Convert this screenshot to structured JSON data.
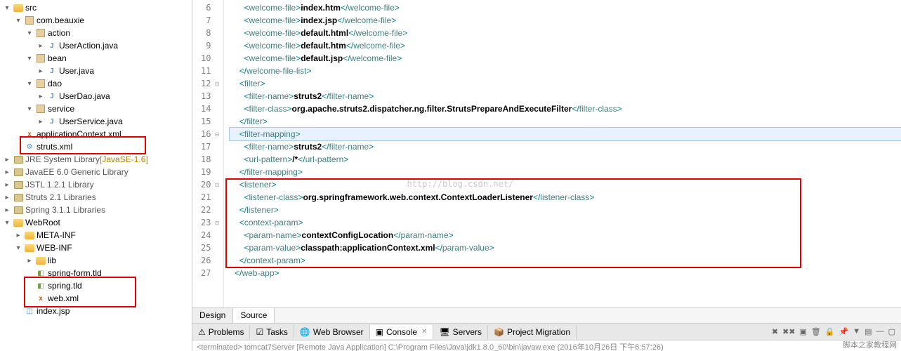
{
  "tree": {
    "items": [
      {
        "ind": 1,
        "tw": "▾",
        "icon": "folder",
        "label": "src"
      },
      {
        "ind": 2,
        "tw": "▾",
        "icon": "package",
        "label": "com.beauxie"
      },
      {
        "ind": 3,
        "tw": "▾",
        "icon": "package",
        "label": "action"
      },
      {
        "ind": 4,
        "tw": "▸",
        "icon": "java",
        "label": "UserAction.java"
      },
      {
        "ind": 3,
        "tw": "▾",
        "icon": "package",
        "label": "bean"
      },
      {
        "ind": 4,
        "tw": "▸",
        "icon": "java",
        "label": "User.java"
      },
      {
        "ind": 3,
        "tw": "▾",
        "icon": "package",
        "label": "dao"
      },
      {
        "ind": 4,
        "tw": "▸",
        "icon": "java",
        "label": "UserDao.java"
      },
      {
        "ind": 3,
        "tw": "▾",
        "icon": "package",
        "label": "service"
      },
      {
        "ind": 4,
        "tw": "▸",
        "icon": "java",
        "label": "UserService.java"
      },
      {
        "ind": 2,
        "tw": "",
        "icon": "xml",
        "label": "applicationContext.xml"
      },
      {
        "ind": 2,
        "tw": "",
        "icon": "gear",
        "label": "struts.xml"
      },
      {
        "ind": 1,
        "tw": "▸",
        "icon": "lib",
        "label": "JRE System Library",
        "ver": "[JavaSE-1.6]",
        "lib": true
      },
      {
        "ind": 1,
        "tw": "▸",
        "icon": "lib",
        "label": "JavaEE 6.0 Generic Library",
        "lib": true
      },
      {
        "ind": 1,
        "tw": "▸",
        "icon": "lib",
        "label": "JSTL 1.2.1 Library",
        "lib": true
      },
      {
        "ind": 1,
        "tw": "▸",
        "icon": "lib",
        "label": "Struts 2.1 Libraries",
        "lib": true
      },
      {
        "ind": 1,
        "tw": "▸",
        "icon": "lib",
        "label": "Spring 3.1.1 Libraries",
        "lib": true
      },
      {
        "ind": 1,
        "tw": "▾",
        "icon": "folder",
        "label": "WebRoot"
      },
      {
        "ind": 2,
        "tw": "▸",
        "icon": "folder",
        "label": "META-INF"
      },
      {
        "ind": 2,
        "tw": "▾",
        "icon": "folder",
        "label": "WEB-INF"
      },
      {
        "ind": 3,
        "tw": "▸",
        "icon": "folder",
        "label": "lib"
      },
      {
        "ind": 3,
        "tw": "",
        "icon": "tld",
        "label": "spring-form.tld"
      },
      {
        "ind": 3,
        "tw": "",
        "icon": "tld",
        "label": "spring.tld"
      },
      {
        "ind": 3,
        "tw": "",
        "icon": "xml",
        "label": "web.xml"
      },
      {
        "ind": 2,
        "tw": "",
        "icon": "jsp",
        "label": "index.jsp"
      }
    ]
  },
  "code": {
    "lines": [
      {
        "n": 6,
        "indent": 3,
        "parts": [
          [
            "tag",
            "<welcome-file>"
          ],
          [
            "txtb",
            "index.htm"
          ],
          [
            "tag",
            "</welcome-file>"
          ]
        ]
      },
      {
        "n": 7,
        "indent": 3,
        "parts": [
          [
            "tag",
            "<welcome-file>"
          ],
          [
            "txtb",
            "index.jsp"
          ],
          [
            "tag",
            "</welcome-file>"
          ]
        ]
      },
      {
        "n": 8,
        "indent": 3,
        "parts": [
          [
            "tag",
            "<welcome-file>"
          ],
          [
            "txtb",
            "default.html"
          ],
          [
            "tag",
            "</welcome-file>"
          ]
        ]
      },
      {
        "n": 9,
        "indent": 3,
        "parts": [
          [
            "tag",
            "<welcome-file>"
          ],
          [
            "txtb",
            "default.htm"
          ],
          [
            "tag",
            "</welcome-file>"
          ]
        ]
      },
      {
        "n": 10,
        "indent": 3,
        "parts": [
          [
            "tag",
            "<welcome-file>"
          ],
          [
            "txtb",
            "default.jsp"
          ],
          [
            "tag",
            "</welcome-file>"
          ]
        ]
      },
      {
        "n": 11,
        "indent": 2,
        "parts": [
          [
            "tag",
            "</welcome-file-list>"
          ]
        ]
      },
      {
        "n": 12,
        "fold": true,
        "indent": 2,
        "parts": [
          [
            "tag",
            "<filter>"
          ]
        ]
      },
      {
        "n": 13,
        "indent": 3,
        "parts": [
          [
            "tag",
            "<filter-name>"
          ],
          [
            "txtb",
            "struts2"
          ],
          [
            "tag",
            "</filter-name>"
          ]
        ]
      },
      {
        "n": 14,
        "indent": 3,
        "parts": [
          [
            "tag",
            "<filter-class>"
          ],
          [
            "txtb",
            "org.apache.struts2.dispatcher.ng.filter.StrutsPrepareAndExecuteFilter"
          ],
          [
            "tag",
            "</filter-class>"
          ]
        ]
      },
      {
        "n": 15,
        "indent": 2,
        "parts": [
          [
            "tag",
            "</filter>"
          ]
        ]
      },
      {
        "n": 16,
        "fold": true,
        "cursor": true,
        "indent": 2,
        "parts": [
          [
            "tag",
            "<filter-mapping>"
          ]
        ]
      },
      {
        "n": 17,
        "indent": 3,
        "parts": [
          [
            "tag",
            "<filter-name>"
          ],
          [
            "txtb",
            "struts2"
          ],
          [
            "tag",
            "</filter-name>"
          ]
        ]
      },
      {
        "n": 18,
        "indent": 3,
        "parts": [
          [
            "tag",
            "<url-pattern>"
          ],
          [
            "txtb",
            "/*"
          ],
          [
            "tag",
            "</url-pattern>"
          ]
        ]
      },
      {
        "n": 19,
        "indent": 2,
        "parts": [
          [
            "tag",
            "</filter-mapping>"
          ]
        ]
      },
      {
        "n": 20,
        "fold": true,
        "indent": 2,
        "parts": [
          [
            "tag",
            "<listener>"
          ]
        ]
      },
      {
        "n": 21,
        "indent": 3,
        "parts": [
          [
            "tag",
            "<listener-class>"
          ],
          [
            "txtb",
            "org.springframework.web.context.ContextLoaderListener"
          ],
          [
            "tag",
            "</listener-class>"
          ]
        ]
      },
      {
        "n": 22,
        "indent": 2,
        "parts": [
          [
            "tag",
            "</listener>"
          ]
        ]
      },
      {
        "n": 23,
        "fold": true,
        "indent": 2,
        "parts": [
          [
            "tag",
            "<context-param>"
          ]
        ]
      },
      {
        "n": 24,
        "indent": 3,
        "parts": [
          [
            "tag",
            "<param-name>"
          ],
          [
            "txtb",
            "contextConfigLocation"
          ],
          [
            "tag",
            "</param-name>"
          ]
        ]
      },
      {
        "n": 25,
        "indent": 3,
        "parts": [
          [
            "tag",
            "<param-value>"
          ],
          [
            "txtb",
            "classpath:applicationContext.xml"
          ],
          [
            "tag",
            "</param-value>"
          ]
        ]
      },
      {
        "n": 26,
        "indent": 2,
        "parts": [
          [
            "tag",
            "</context-param>"
          ]
        ]
      },
      {
        "n": 27,
        "indent": 1,
        "parts": [
          [
            "tag",
            "</web-app>"
          ]
        ]
      }
    ],
    "watermark": "http://blog.csdn.net/"
  },
  "bottomTabs": {
    "design": "Design",
    "source": "Source"
  },
  "views": [
    {
      "icon": "problems",
      "label": "Problems"
    },
    {
      "icon": "tasks",
      "label": "Tasks"
    },
    {
      "icon": "wb",
      "label": "Web Browser"
    },
    {
      "icon": "console",
      "label": "Console",
      "active": true,
      "close": true
    },
    {
      "icon": "servers",
      "label": "Servers"
    },
    {
      "icon": "pm",
      "label": "Project Migration"
    }
  ],
  "status": "<terminated> tomcat7Server [Remote Java Application] C:\\Program Files\\Java\\jdk1.8.0_60\\bin\\javaw.exe (2016年10月26日 下午6:57:26)",
  "brand": "脚本之家教程网"
}
